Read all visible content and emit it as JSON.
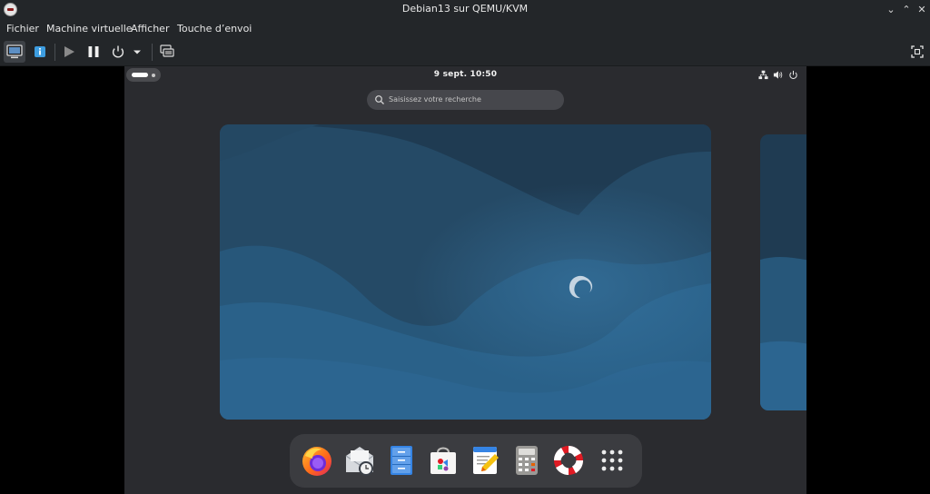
{
  "window": {
    "title": "Debian13 sur QEMU/KVM",
    "controls": [
      "minimize",
      "maximize",
      "close"
    ]
  },
  "menu": [
    "Fichier",
    "Machine virtuelle",
    "Afficher",
    "Touche d’envoi"
  ],
  "toolbar": {
    "buttons": [
      "console-view",
      "details-view",
      "run",
      "pause",
      "shutdown",
      "shutdown-menu",
      "snapshots",
      "fullscreen"
    ]
  },
  "guest": {
    "clock": "9 sept.  10:50",
    "search_placeholder": "Saisissez votre recherche",
    "status_icons": [
      "network-icon",
      "volume-icon",
      "power-icon"
    ],
    "wallpaper_colors": {
      "dark": "#213c52",
      "mid": "#254a66",
      "light": "#2c6590"
    },
    "dash_apps": [
      "Firefox",
      "Evolution",
      "Fichiers",
      "Logiciels",
      "Éditeur de texte",
      "Calculatrice",
      "Aide",
      "Afficher les applications"
    ]
  }
}
